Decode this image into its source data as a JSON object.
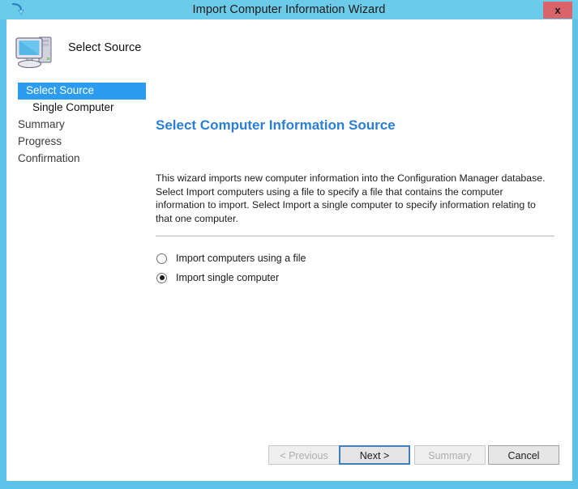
{
  "window": {
    "title": "Import Computer Information Wizard",
    "title_icon": "import-arrow-icon",
    "close_label": "x",
    "frame_color": "#5dc2e8",
    "titlebar_color": "#6ccbe9",
    "close_color": "#d9656a"
  },
  "header": {
    "icon": "computer-icon",
    "title": "Select Source"
  },
  "sidebar": {
    "items": [
      {
        "label": "Select Source",
        "selected": true,
        "sub": false
      },
      {
        "label": "Single Computer",
        "selected": false,
        "sub": true
      },
      {
        "label": "Summary",
        "selected": false,
        "sub": false
      },
      {
        "label": "Progress",
        "selected": false,
        "sub": false
      },
      {
        "label": "Confirmation",
        "selected": false,
        "sub": false
      }
    ],
    "selected_color": "#2b9cf0"
  },
  "main": {
    "heading": "Select Computer Information Source",
    "heading_color": "#2a7fd4",
    "paragraph": "This wizard imports new computer information into the Configuration Manager database. Select Import computers using a file to specify a file that contains the computer information to import. Select Import a single computer to specify information relating to that one computer.",
    "options": [
      {
        "label": "Import computers using a file",
        "checked": false
      },
      {
        "label": "Import single computer",
        "checked": true
      }
    ]
  },
  "footer": {
    "buttons": [
      {
        "label": "< Previous",
        "state": "disabled"
      },
      {
        "label": "Next >",
        "state": "focused"
      },
      {
        "label": "Summary",
        "state": "disabled"
      },
      {
        "label": "Cancel",
        "state": "enabled"
      }
    ]
  }
}
